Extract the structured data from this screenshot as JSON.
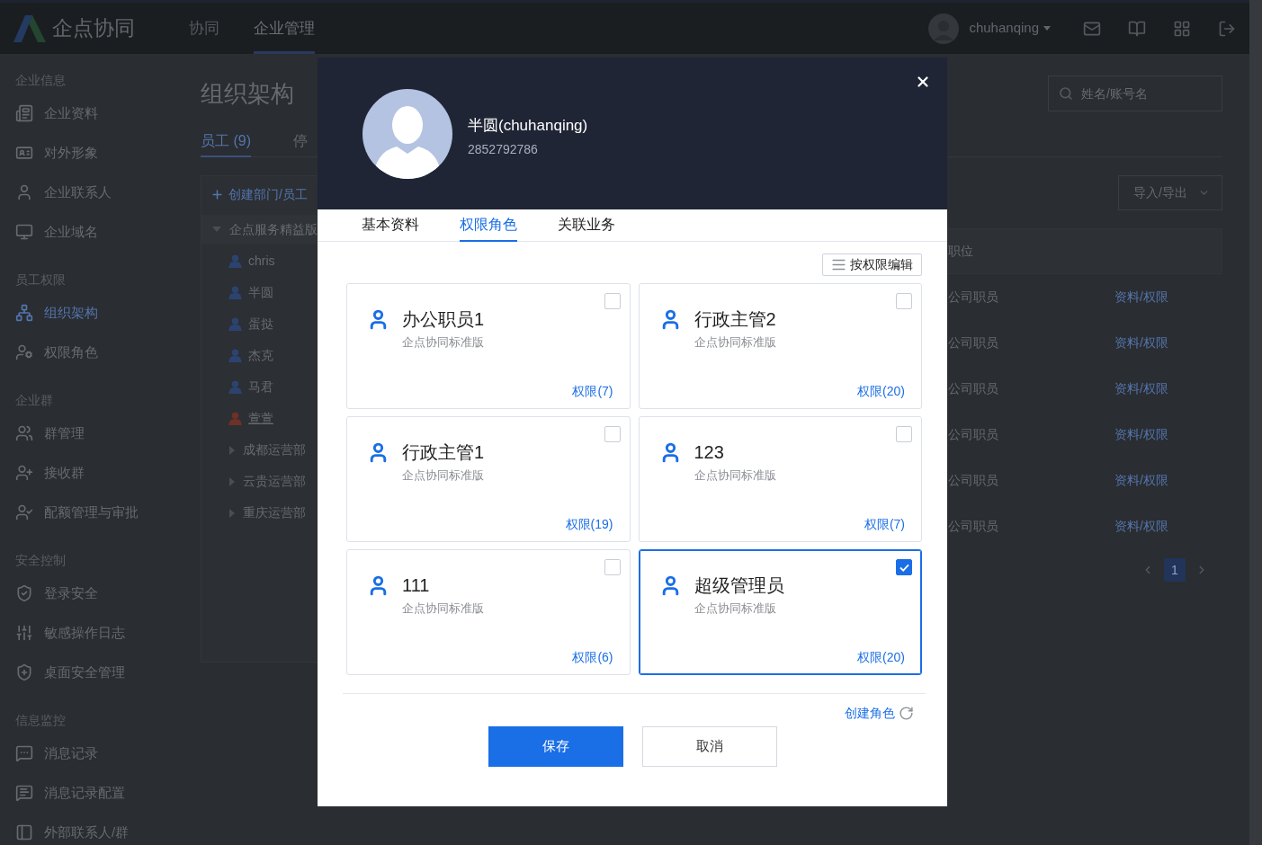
{
  "header": {
    "logo": "企点协同",
    "nav": [
      {
        "label": "协同",
        "selected": false
      },
      {
        "label": "企业管理",
        "selected": true
      }
    ],
    "user": "chuhanqing"
  },
  "sidebar": {
    "sections": [
      {
        "title": "企业信息",
        "items": [
          {
            "label": "企业资料",
            "selected": false
          },
          {
            "label": "对外形象",
            "selected": false
          },
          {
            "label": "企业联系人",
            "selected": false
          },
          {
            "label": "企业域名",
            "selected": false
          }
        ]
      },
      {
        "title": "员工权限",
        "items": [
          {
            "label": "组织架构",
            "selected": true
          },
          {
            "label": "权限角色",
            "selected": false
          }
        ]
      },
      {
        "title": "企业群",
        "items": [
          {
            "label": "群管理",
            "selected": false
          },
          {
            "label": "接收群",
            "selected": false
          },
          {
            "label": "配额管理与审批",
            "selected": false
          }
        ]
      },
      {
        "title": "安全控制",
        "items": [
          {
            "label": "登录安全",
            "selected": false
          },
          {
            "label": "敏感操作日志",
            "selected": false
          },
          {
            "label": "桌面安全管理",
            "selected": false
          }
        ]
      },
      {
        "title": "信息监控",
        "items": [
          {
            "label": "消息记录",
            "selected": false
          },
          {
            "label": "消息记录配置",
            "selected": false
          },
          {
            "label": "外部联系人/群",
            "selected": false
          }
        ]
      }
    ]
  },
  "page": {
    "title": "组织架构",
    "tabs": [
      {
        "label": "员工 (9)",
        "selected": true
      },
      {
        "label": "停",
        "selected": false
      }
    ],
    "search": {
      "placeholder": "姓名/账号名"
    },
    "create_button": "创建部门/员工",
    "tree": {
      "label": "企点服务精益版",
      "expanded": true,
      "children": [
        {
          "kind": "member",
          "name": "chris",
          "color": "#2c4370",
          "hovered": false
        },
        {
          "kind": "member",
          "name": "半圆",
          "color": "#2c4370",
          "hovered": false
        },
        {
          "kind": "member",
          "name": "蛋挞",
          "color": "#2c4370",
          "hovered": false
        },
        {
          "kind": "member",
          "name": "杰克",
          "color": "#2c4370",
          "hovered": false
        },
        {
          "kind": "member",
          "name": "马君",
          "color": "#2c4370",
          "hovered": false
        },
        {
          "kind": "member",
          "name": "萱萱",
          "color": "#6e3028",
          "hovered": true
        },
        {
          "kind": "department",
          "name": "成都运营部",
          "expanded": false
        },
        {
          "kind": "department",
          "name": "云贵运营部",
          "expanded": false
        },
        {
          "kind": "department",
          "name": "重庆运营部",
          "expanded": false
        }
      ]
    },
    "import_export": "导入/导出",
    "table": {
      "columns": [
        "职位"
      ],
      "rows": [
        {
          "position": "公司职员",
          "action": "资料/权限"
        },
        {
          "position": "公司职员",
          "action": "资料/权限"
        },
        {
          "position": "公司职员",
          "action": "资料/权限"
        },
        {
          "position": "公司职员",
          "action": "资料/权限"
        },
        {
          "position": "公司职员",
          "action": "资料/权限"
        },
        {
          "position": "公司职员",
          "action": "资料/权限"
        }
      ]
    },
    "pagination": [
      {
        "label": "1",
        "selected": true
      }
    ]
  },
  "dialog": {
    "user": {
      "name": "半圆(chuhanqing)",
      "id": "2852792786"
    },
    "tabs": [
      {
        "label": "基本资料",
        "selected": false
      },
      {
        "label": "权限角色",
        "selected": true
      },
      {
        "label": "关联业务",
        "selected": false
      }
    ],
    "edit_button": "按权限编辑",
    "roles": [
      {
        "name": "办公职员1",
        "edition": "企点协同标准版",
        "permissions": "权限(7)",
        "checked": false
      },
      {
        "name": "行政主管2",
        "edition": "企点协同标准版",
        "permissions": "权限(20)",
        "checked": false
      },
      {
        "name": "行政主管1",
        "edition": "企点协同标准版",
        "permissions": "权限(19)",
        "checked": false
      },
      {
        "name": "123",
        "edition": "企点协同标准版",
        "permissions": "权限(7)",
        "checked": false
      },
      {
        "name": "111",
        "edition": "企点协同标准版",
        "permissions": "权限(6)",
        "checked": false
      },
      {
        "name": "超级管理员",
        "edition": "企点协同标准版",
        "permissions": "权限(20)",
        "checked": true
      }
    ],
    "create_role": "创建角色",
    "save": "保存",
    "cancel": "取消"
  }
}
